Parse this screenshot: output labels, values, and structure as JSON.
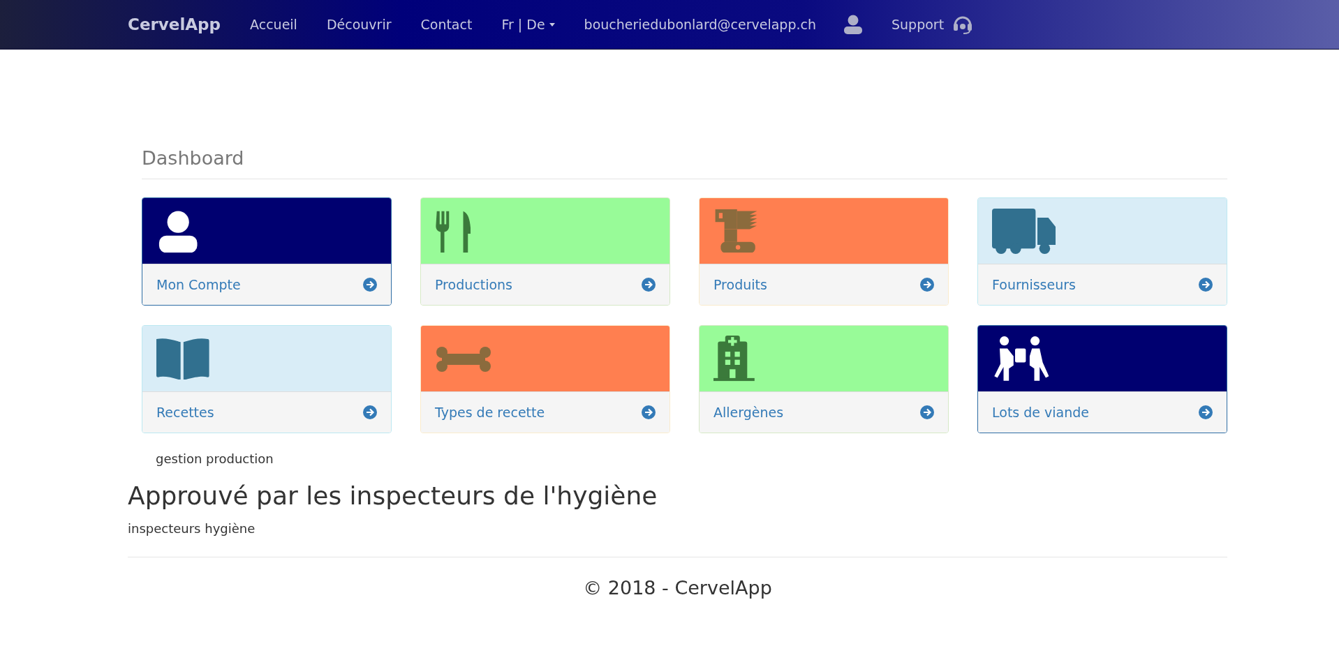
{
  "navbar": {
    "brand": "CervelApp",
    "links": [
      "Accueil",
      "Découvrir",
      "Contact"
    ],
    "language": "Fr | De",
    "email": "boucheriedubonlard@cervelapp.ch",
    "support": "Support"
  },
  "dashboard": {
    "title": "Dashboard",
    "cards": [
      {
        "label": "Mon Compte",
        "kind": "user",
        "color": "#000070"
      },
      {
        "label": "Productions",
        "kind": "utensils",
        "color": "#98fb98"
      },
      {
        "label": "Produits",
        "kind": "grinder",
        "color": "#ff7f50"
      },
      {
        "label": "Fournisseurs",
        "kind": "truck",
        "color": "#d9edf7"
      },
      {
        "label": "Recettes",
        "kind": "book",
        "color": "#d9edf7"
      },
      {
        "label": "Types de recette",
        "kind": "bone",
        "color": "#ff7f50"
      },
      {
        "label": "Allergènes",
        "kind": "hospital",
        "color": "#98fb98"
      },
      {
        "label": "Lots de viande",
        "kind": "carry",
        "color": "#000070"
      }
    ]
  },
  "image_caption": "gestion production",
  "approval": {
    "heading": "Approuvé par les inspecteurs de l'hygiène",
    "caption": "inspecteurs hygiène"
  },
  "footer": "© 2018 - CervelApp"
}
